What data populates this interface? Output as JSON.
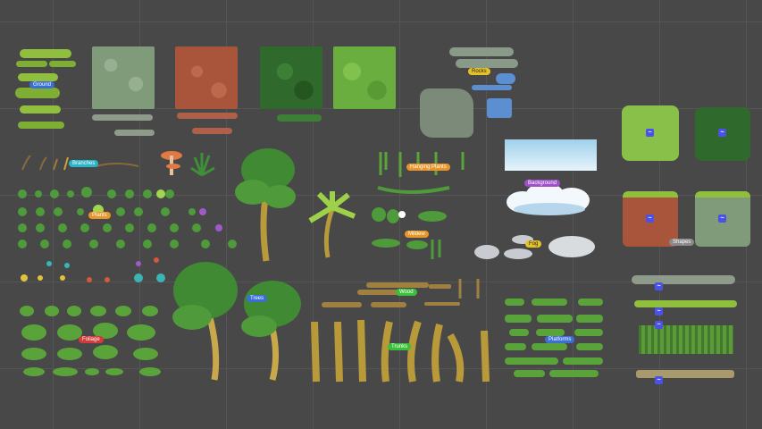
{
  "labels": {
    "ground": "Ground",
    "rocks": "Rocks",
    "branches": "Branches",
    "hanging_plants": "Hanging Plants",
    "background": "Background",
    "plants": "Plants",
    "mildew": "Mildew",
    "fog": "Fog",
    "shapes": "Shapes",
    "wood": "Wood",
    "trees": "Trees",
    "trunks": "Trunks",
    "foliage": "Foliage",
    "platforms": "Platforms"
  },
  "colors": {
    "canvas": "#484848",
    "grid": "#555555",
    "tag_blue": "#3a6fd8",
    "tag_yellow": "#e6c22a",
    "tag_green": "#3bbf3b",
    "tag_orange": "#e8962a",
    "tag_purple": "#a050c8",
    "tag_red": "#d43a3a",
    "tag_cyan": "#2ab4c8",
    "tag_gray": "#8a8a8a",
    "badge": "#4a52e8"
  },
  "badge_icon": "sprite-shape-icon"
}
